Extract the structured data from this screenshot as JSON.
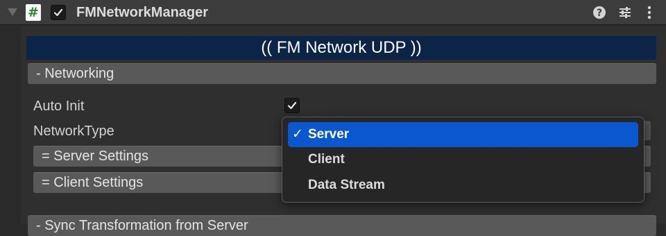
{
  "header": {
    "title": "FMNetworkManager",
    "component_enabled": true,
    "icons": [
      "fold-triangle-icon",
      "hash-script-icon",
      "help-icon",
      "sliders-icon",
      "kebab-menu-icon"
    ]
  },
  "banner": {
    "text": "(( FM Network UDP ))"
  },
  "networking": {
    "section_label": "- Networking",
    "auto_init": {
      "label": "Auto Init",
      "checked": true
    },
    "network_type": {
      "label": "NetworkType",
      "selected": "Server"
    },
    "server_settings_label": "= Server Settings",
    "client_settings_label": "= Client Settings"
  },
  "dropdown": {
    "check_glyph": "✓",
    "options": [
      {
        "label": "Server",
        "selected": true
      },
      {
        "label": "Client",
        "selected": false
      },
      {
        "label": "Data Stream",
        "selected": false
      }
    ]
  },
  "next_section_label": "- Sync Transformation from Server",
  "colors": {
    "banner_bg": "#0c2448",
    "selected_item_bg": "#0a58d0",
    "script_icon_green": "#2f8a3a"
  }
}
